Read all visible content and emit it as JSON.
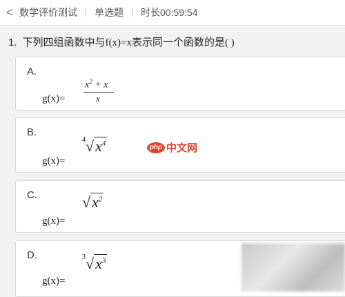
{
  "header": {
    "back_icon": "chevron-left-icon",
    "back_glyph": "<",
    "title": "数学评价测试",
    "type": "单选题",
    "timer": "时长00:59:54"
  },
  "question": {
    "number": "1.",
    "text": "下列四组函数中与f(x)=x表示同一个函数的是(        )"
  },
  "options": [
    {
      "letter": "A.",
      "fx": "g(x)=",
      "expr": "(x²+x)/x"
    },
    {
      "letter": "B.",
      "fx": "g(x)=",
      "expr": "⁴√(x⁴)"
    },
    {
      "letter": "C.",
      "fx": "g(x)=",
      "expr": "√(x²)"
    },
    {
      "letter": "D.",
      "fx": "g(x)=",
      "expr": "³√(x³)"
    }
  ],
  "watermark": {
    "logo": "php",
    "text": "中文网"
  }
}
